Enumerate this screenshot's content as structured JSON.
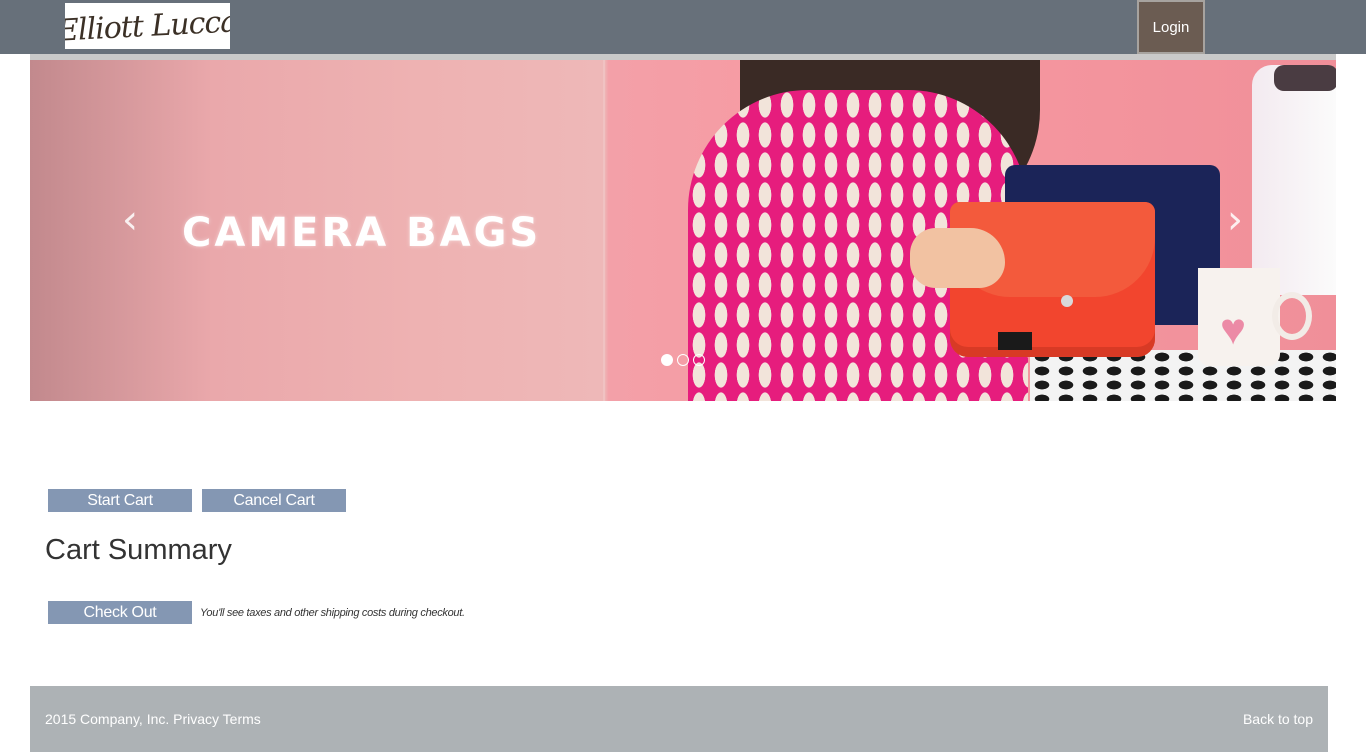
{
  "header": {
    "logo_text": "Elliott Lucca",
    "login_label": "Login"
  },
  "carousel": {
    "slide_title": "CAMERA BAGS",
    "prev_icon": "chevron-left-icon",
    "next_icon": "chevron-right-icon",
    "slide_count": 3,
    "active_slide": 1
  },
  "cart": {
    "start_label": "Start Cart",
    "cancel_label": "Cancel Cart",
    "summary_title": "Cart Summary",
    "checkout_label": "Check Out",
    "checkout_note": "You'll see taxes and other shipping costs during checkout."
  },
  "footer": {
    "copyright": "2015 Company, Inc. Privacy Terms",
    "back_to_top": "Back to top"
  },
  "colors": {
    "topbar": "#67707a",
    "login_bg": "#6b5c52",
    "button_bg": "#8497b3",
    "footer_bg": "#adb2b5"
  }
}
